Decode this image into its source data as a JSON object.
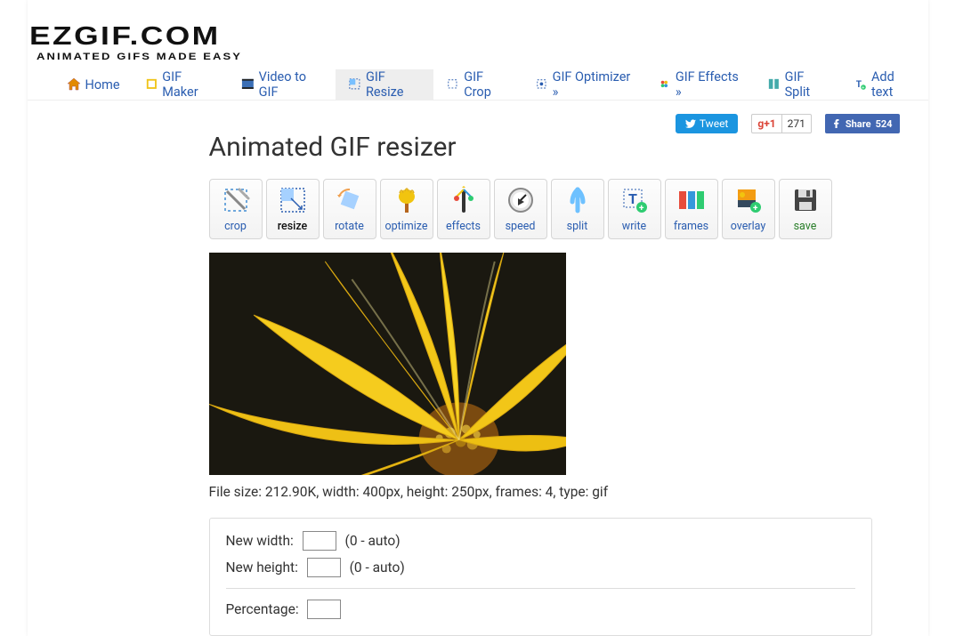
{
  "brand": {
    "title": "EZGIF.COM",
    "sub": "ANIMATED GIFS MADE EASY"
  },
  "nav": {
    "home": "Home",
    "maker": "GIF Maker",
    "video": "Video to GIF",
    "resize": "GIF Resize",
    "crop": "GIF Crop",
    "optimizer": "GIF Optimizer »",
    "effects": "GIF Effects »",
    "split": "GIF Split",
    "addtext": "Add text"
  },
  "share": {
    "tweet": "Tweet",
    "gplus_logo": "g+1",
    "gplus_count": "271",
    "fb_label": "Share",
    "fb_count": "524"
  },
  "page": {
    "title": "Animated GIF resizer"
  },
  "tools": {
    "crop": "crop",
    "resize": "resize",
    "rotate": "rotate",
    "optimize": "optimize",
    "effects": "effects",
    "speed": "speed",
    "split": "split",
    "write": "write",
    "frames": "frames",
    "overlay": "overlay",
    "save": "save"
  },
  "preview": {
    "meta": "File size: 212.90K, width: 400px, height: 250px, frames: 4, type: gif"
  },
  "form": {
    "width_label": "New width:",
    "width_hint": "(0 - auto)",
    "height_label": "New height:",
    "height_hint": "(0 - auto)",
    "percent_label": "Percentage:"
  }
}
